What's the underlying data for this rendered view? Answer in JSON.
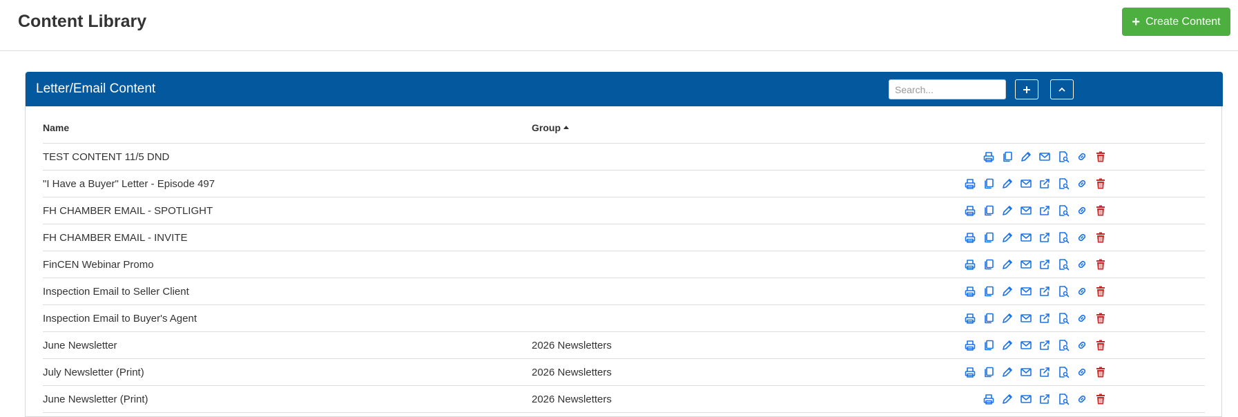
{
  "page": {
    "title": "Content Library",
    "create_button_label": "Create Content"
  },
  "panel": {
    "title": "Letter/Email Content",
    "search_placeholder": "Search..."
  },
  "table": {
    "columns": {
      "name": "Name",
      "group": "Group"
    },
    "sort": {
      "column": "Group",
      "direction": "ascending"
    },
    "rows": [
      {
        "name": "TEST CONTENT 11/5 DND",
        "group": "",
        "actions": [
          "print",
          "copy",
          "edit",
          "email",
          "preview",
          "link",
          "delete"
        ]
      },
      {
        "name": "\"I Have a Buyer\" Letter - Episode 497",
        "group": "",
        "actions": [
          "print",
          "copy",
          "edit",
          "email",
          "share",
          "preview",
          "link",
          "delete"
        ]
      },
      {
        "name": "FH CHAMBER EMAIL - SPOTLIGHT",
        "group": "",
        "actions": [
          "print",
          "copy",
          "edit",
          "email",
          "share",
          "preview",
          "link",
          "delete"
        ]
      },
      {
        "name": "FH CHAMBER EMAIL - INVITE",
        "group": "",
        "actions": [
          "print",
          "copy",
          "edit",
          "email",
          "share",
          "preview",
          "link",
          "delete"
        ]
      },
      {
        "name": "FinCEN Webinar Promo",
        "group": "",
        "actions": [
          "print",
          "copy",
          "edit",
          "email",
          "share",
          "preview",
          "link",
          "delete"
        ]
      },
      {
        "name": "Inspection Email to Seller Client",
        "group": "",
        "actions": [
          "print",
          "copy",
          "edit",
          "email",
          "share",
          "preview",
          "link",
          "delete"
        ]
      },
      {
        "name": "Inspection Email to Buyer's Agent",
        "group": "",
        "actions": [
          "print",
          "copy",
          "edit",
          "email",
          "share",
          "preview",
          "link",
          "delete"
        ]
      },
      {
        "name": "June Newsletter",
        "group": "2026 Newsletters",
        "actions": [
          "print",
          "copy",
          "edit",
          "email",
          "share",
          "preview",
          "link",
          "delete"
        ]
      },
      {
        "name": "July Newsletter (Print)",
        "group": "2026 Newsletters",
        "actions": [
          "print",
          "copy",
          "edit",
          "email",
          "share",
          "preview",
          "link",
          "delete"
        ]
      },
      {
        "name": "June Newsletter (Print)",
        "group": "2026 Newsletters",
        "actions": [
          "print",
          "edit",
          "email",
          "share",
          "preview",
          "link",
          "delete"
        ]
      }
    ]
  },
  "colors": {
    "header_blue": "#03589e",
    "create_green": "#4caf3f",
    "action_icon_blue": "#1a73e8",
    "delete_red": "#c62828"
  }
}
